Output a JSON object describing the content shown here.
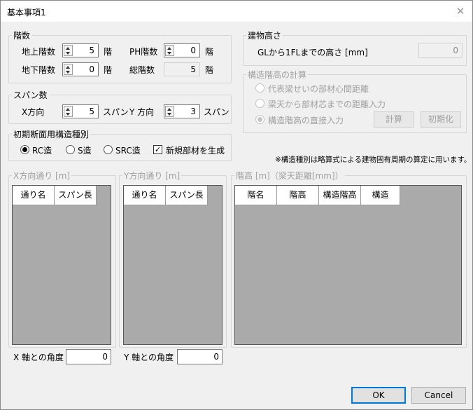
{
  "window": {
    "title": "基本事項1"
  },
  "floors": {
    "legend": "階数",
    "above_label": "地上階数",
    "above_value": "5",
    "above_unit": "階",
    "below_label": "地下階数",
    "below_value": "0",
    "below_unit": "階",
    "ph_label": "PH階数",
    "ph_value": "0",
    "ph_unit": "階",
    "total_label": "総階数",
    "total_value": "5",
    "total_unit": "階"
  },
  "span": {
    "legend": "スパン数",
    "x_label": "X方向",
    "x_value": "5",
    "x_unit": "スパン",
    "y_label": "Y 方向",
    "y_value": "3",
    "y_unit": "スパン"
  },
  "structure": {
    "legend": "初期断面用構造種別",
    "rc": "RC造",
    "s": "S造",
    "src": "SRC造",
    "selected": "RC造",
    "generate_label": "新規部材を生成",
    "generate_checked": true
  },
  "building_height": {
    "legend": "建物高さ",
    "label": "GLから1FLまでの高さ [mm]",
    "value": "0"
  },
  "story_calc": {
    "legend": "構造階高の計算",
    "opt1": "代表梁せいの部材心間距離",
    "opt2": "梁天から部材芯までの距離入力",
    "opt3": "構造階高の直接入力",
    "selected": "構造階高の直接入力",
    "calc_button": "計算",
    "reset_button": "初期化"
  },
  "note": "※構造種別は略算式による建物固有周期の算定に用います。",
  "x_grid": {
    "legend": "X方向通り [m]",
    "columns": [
      "通り名",
      "スパン長"
    ]
  },
  "y_grid": {
    "legend": "Y方向通り [m]",
    "columns": [
      "通り名",
      "スパン長"
    ]
  },
  "story_grid": {
    "legend": "階高 [m]（梁天距離[mm]）",
    "columns": [
      "階名",
      "階高",
      "構造階高",
      "構造"
    ]
  },
  "x_angle": {
    "label": "X 軸との角度",
    "value": "0"
  },
  "y_angle": {
    "label": "Y 軸との角度",
    "value": "0"
  },
  "buttons": {
    "ok": "OK",
    "cancel": "Cancel"
  }
}
